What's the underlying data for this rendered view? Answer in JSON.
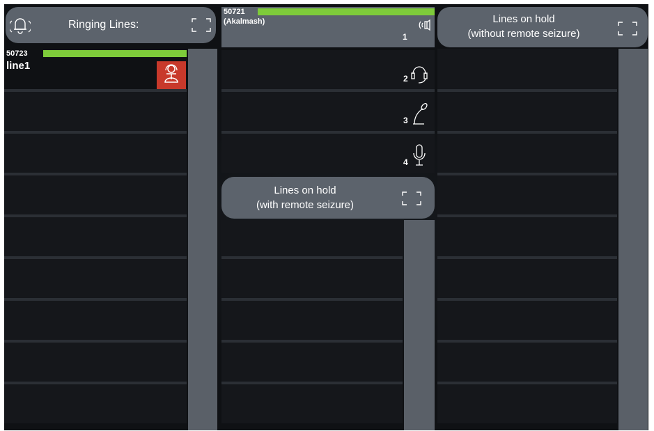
{
  "ringing_panel": {
    "header_label": "Ringing Lines:",
    "icon": "bell-icon",
    "expand_icon": "expand-icon",
    "call": {
      "number": "50723",
      "name": "line1",
      "status_color": "#7ecb3a",
      "handset_color": "#c8392b",
      "icon": "handset-icon"
    }
  },
  "active_panel": {
    "call": {
      "number": "50721",
      "name": "(Akalmash)",
      "slot": "1",
      "status_color": "#7ecb3a",
      "icon": "speaker-icon"
    },
    "slots": [
      {
        "slot": "2",
        "icon": "headset-icon"
      },
      {
        "slot": "3",
        "icon": "gooseneck-mic-icon"
      },
      {
        "slot": "4",
        "icon": "microphone-icon"
      }
    ],
    "hold_remote": {
      "label_line1": "Lines on hold",
      "label_line2": "(with remote seizure)",
      "expand_icon": "expand-icon"
    }
  },
  "hold_panel": {
    "label_line1": "Lines on hold",
    "label_line2": "(without remote seizure)",
    "expand_icon": "expand-icon"
  },
  "colors": {
    "background": "#0f1114",
    "row": "#15171b",
    "lane": "#5a6068",
    "pill": "#5c636c",
    "accent_green": "#7ecb3a",
    "alert_red": "#c8392b"
  }
}
